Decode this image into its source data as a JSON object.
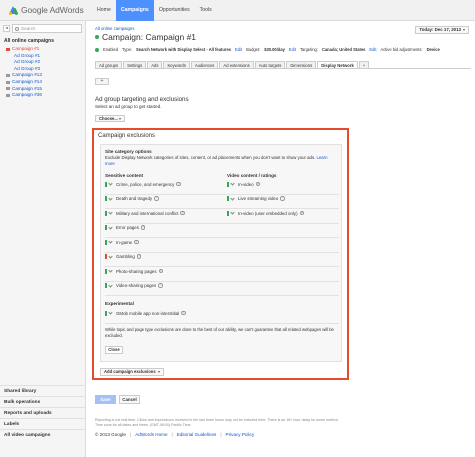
{
  "header": {
    "logo_text": "Google AdWords",
    "nav": [
      "Home",
      "Campaigns",
      "Opportunities",
      "Tools"
    ],
    "active_nav": "Campaigns",
    "colors": {
      "nav_active": "#4d90fe",
      "highlight_border": "#e64b2b"
    }
  },
  "sidebar": {
    "search_placeholder": "Search",
    "tree_head": "All online campaigns",
    "items": [
      {
        "label": "Campaign #1",
        "type": "campaign",
        "selected": true
      },
      {
        "label": "Ad Group #1",
        "type": "adgroup"
      },
      {
        "label": "Ad Group #2",
        "type": "adgroup"
      },
      {
        "label": "Ad Group #3",
        "type": "adgroup"
      },
      {
        "label": "Campaign #13",
        "type": "campaign"
      },
      {
        "label": "Campaign #14",
        "type": "campaign"
      },
      {
        "label": "Campaign #15",
        "type": "campaign"
      },
      {
        "label": "Campaign #36",
        "type": "campaign"
      }
    ],
    "links": [
      "Shared library",
      "Bulk operations",
      "Reports and uploads",
      "Labels",
      "All video campaigns"
    ]
  },
  "main": {
    "breadcrumb": "All online campaigns",
    "title": "Campaign: Campaign #1",
    "date_range": "Today: Dec 17, 2013",
    "settings": {
      "status": "Enabled",
      "type_label": "Type:",
      "type_value": "Search Network with Display Select - All features",
      "type_edit": "Edit",
      "budget_label": "Budget:",
      "budget_value": "$30.00/day",
      "budget_edit": "Edit",
      "targeting_label": "Targeting:",
      "targeting_value": "Canada; United States",
      "targeting_edit": "Edit",
      "bid_label": "Active bid adjustments:",
      "bid_value": "Device"
    },
    "tabs": [
      "Ad groups",
      "Settings",
      "Ads",
      "Keywords",
      "Audiences",
      "Ad extensions",
      "Auto targets",
      "Dimensions",
      "Display Network",
      "+"
    ],
    "active_tab": "Display Network",
    "add_button": "+",
    "section_title": "Ad group targeting and exclusions",
    "section_sub": "Select an ad group to get started.",
    "choose_button": "Choose...",
    "exclusions": {
      "title": "Campaign exclusions",
      "options_head": "Site category options",
      "options_desc": "Exclude Display Network categories of sites, content, or ad placements when you don't want to show your ads.",
      "learn_more": "Learn more",
      "sensitive_head": "Sensitive content",
      "sensitive": [
        {
          "label": "Crime, police, and emergency",
          "status": "on"
        },
        {
          "label": "Death and tragedy",
          "status": "on"
        },
        {
          "label": "Military and international conflict",
          "status": "on"
        },
        {
          "label": "Error pages",
          "status": "on"
        },
        {
          "label": "In-game",
          "status": "on"
        },
        {
          "label": "Gambling",
          "status": "off"
        },
        {
          "label": "Photo-sharing pages",
          "status": "on"
        },
        {
          "label": "Video-sharing pages",
          "status": "on"
        }
      ],
      "video_head": "Video content / ratings",
      "video": [
        {
          "label": "In-video",
          "status": "on"
        },
        {
          "label": "Live streaming video",
          "status": "on"
        },
        {
          "label": "In-video (user embedded only)",
          "status": "on"
        }
      ],
      "experimental_head": "Experimental",
      "experimental": [
        {
          "label": "GMob mobile app non-interstitial",
          "status": "on"
        }
      ],
      "note": "While topic and page type exclusions are done to the best of our ability, we can't guarantee that all related webpages will be excluded.",
      "close_button": "Close",
      "add_button": "Add campaign exclusions"
    },
    "save_button": "Save",
    "cancel_button": "Cancel",
    "footer_note": "Reporting is not real-time. Clicks and impressions received in the last three hours may not be included here. There is an 18+ hour delay for some metrics. Time zone for all dates and times: (GMT-08:00) Pacific Time.",
    "footer_links": [
      "© 2013 Google",
      "AdWords Home",
      "Editorial Guidelines",
      "Privacy Policy"
    ]
  }
}
